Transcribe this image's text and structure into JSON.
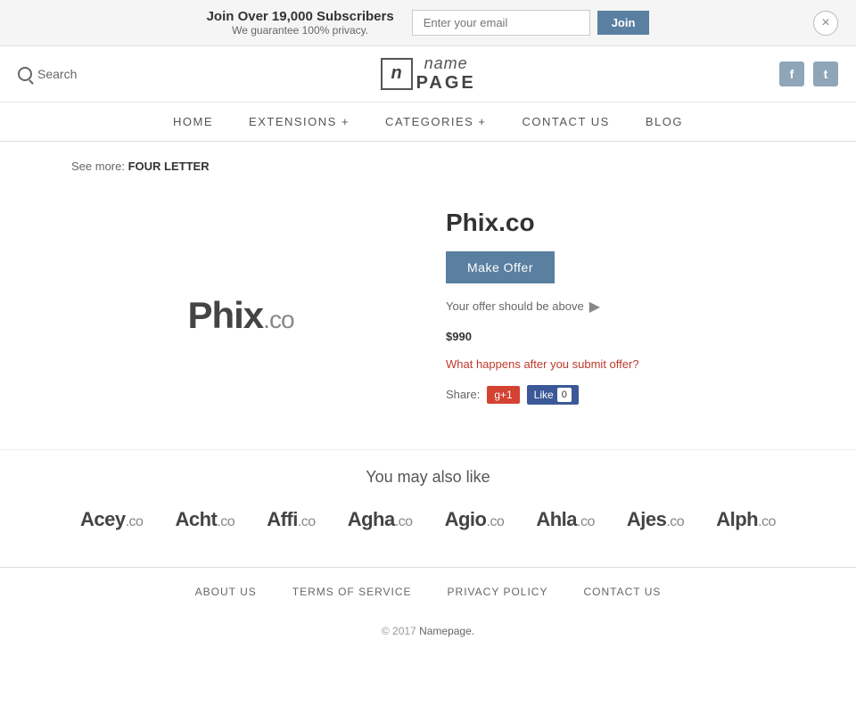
{
  "banner": {
    "title": "Join Over 19,000 Subscribers",
    "subtitle": "We guarantee 100% privacy.",
    "email_placeholder": "Enter your email",
    "join_label": "Join",
    "close_label": "×"
  },
  "header": {
    "search_label": "Search",
    "logo_icon": "n",
    "logo_name": "name",
    "logo_page": "PAGE",
    "facebook_label": "f",
    "twitter_label": "t"
  },
  "nav": {
    "items": [
      {
        "label": "HOME",
        "id": "home"
      },
      {
        "label": "EXTENSIONS +",
        "id": "extensions"
      },
      {
        "label": "CATEGORIES +",
        "id": "categories"
      },
      {
        "label": "CONTACT US",
        "id": "contact"
      },
      {
        "label": "BLOG",
        "id": "blog"
      }
    ]
  },
  "breadcrumb": {
    "see_more_label": "See more:",
    "category_label": "FOUR LETTER"
  },
  "domain": {
    "name": "Phix",
    "suffix": ".co",
    "full": "Phix.co",
    "make_offer_label": "Make Offer",
    "offer_info": "Your offer should be above",
    "offer_price": "$990",
    "what_happens_label": "What happens after you submit offer?",
    "share_label": "Share:",
    "gplus_label": "g+1",
    "fb_like_label": "Like",
    "fb_count": "0"
  },
  "similar": {
    "title": "You may also like",
    "domains": [
      {
        "name": "Acey",
        "tld": ".co"
      },
      {
        "name": "Acht",
        "tld": ".co"
      },
      {
        "name": "Affi",
        "tld": ".co"
      },
      {
        "name": "Agha",
        "tld": ".co"
      },
      {
        "name": "Agio",
        "tld": ".co"
      },
      {
        "name": "Ahla",
        "tld": ".co"
      },
      {
        "name": "Ajes",
        "tld": ".co"
      },
      {
        "name": "Alph",
        "tld": ".co"
      }
    ]
  },
  "footer": {
    "links": [
      {
        "label": "ABOUT US",
        "id": "about"
      },
      {
        "label": "TERMS OF SERVICE",
        "id": "terms"
      },
      {
        "label": "PRIVACY POLICY",
        "id": "privacy"
      },
      {
        "label": "CONTACT US",
        "id": "contact"
      }
    ],
    "copyright": "© 2017",
    "brand": "Namepage."
  }
}
